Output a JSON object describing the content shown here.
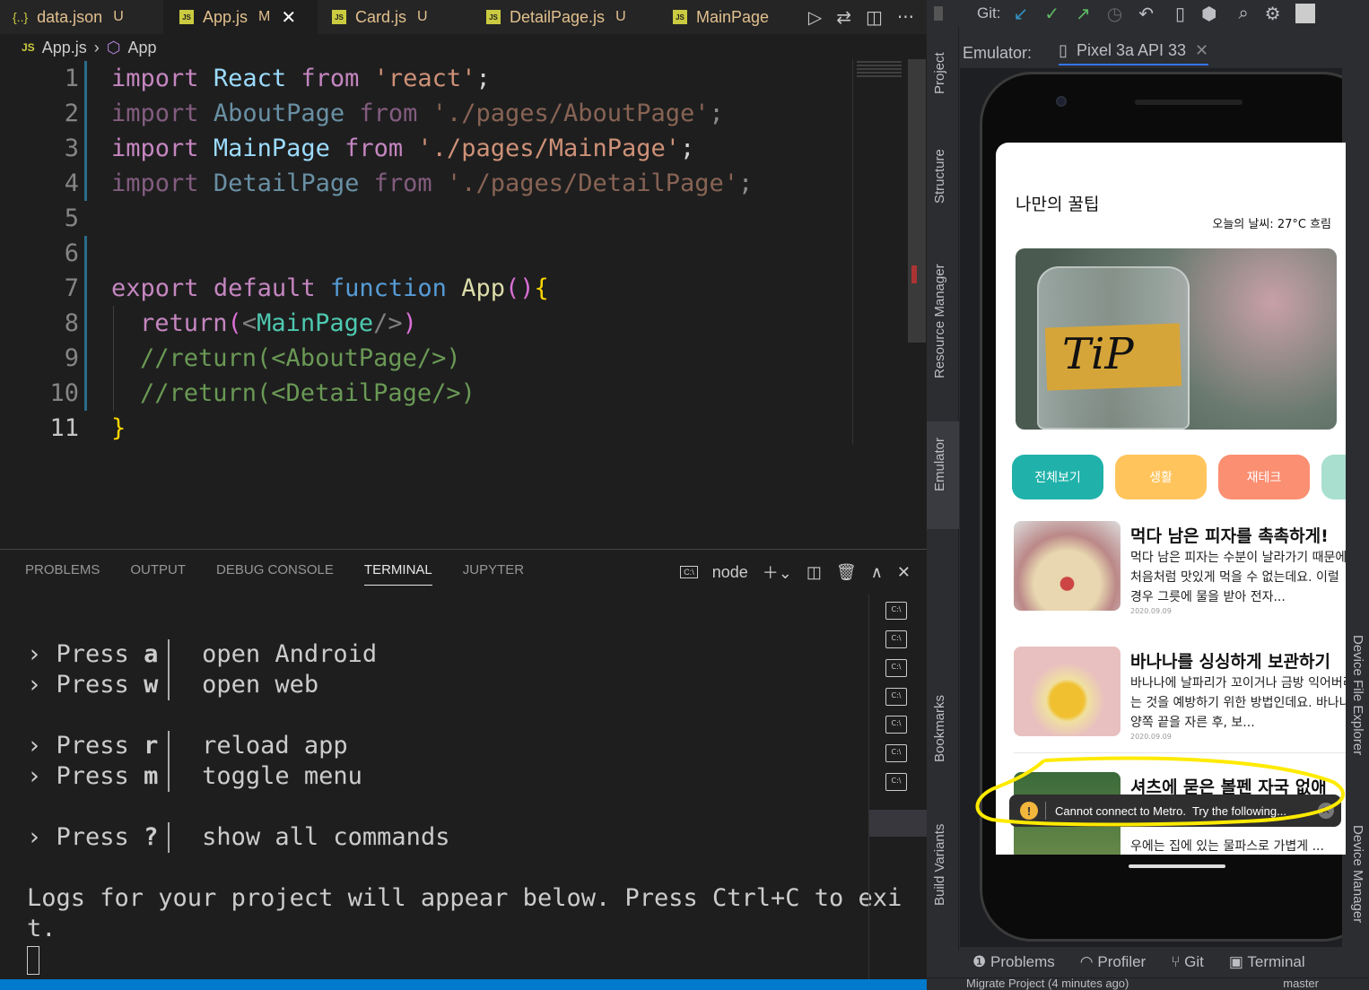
{
  "editor": {
    "tabs": [
      {
        "icon": "{..}",
        "name": "data.json",
        "status": "U"
      },
      {
        "icon": "JS",
        "name": "App.js",
        "status": "M"
      },
      {
        "icon": "JS",
        "name": "Card.js",
        "status": "U"
      },
      {
        "icon": "JS",
        "name": "DetailPage.js",
        "status": "U"
      },
      {
        "icon": "JS",
        "name": "MainPage",
        "status": ""
      }
    ],
    "breadcrumb": {
      "file": "App.js",
      "symbol": "App"
    },
    "line_numbers": [
      "1",
      "2",
      "3",
      "4",
      "5",
      "6",
      "7",
      "8",
      "9",
      "10",
      "11"
    ],
    "code": {
      "l1": [
        "import",
        "React",
        "from",
        "'react'",
        ";"
      ],
      "l2": [
        "import",
        "AboutPage",
        "from",
        "'./pages/AboutPage'",
        ";"
      ],
      "l3": [
        "import",
        "MainPage",
        "from",
        "'./pages/MainPage'",
        ";"
      ],
      "l4": [
        "import",
        "DetailPage",
        "from",
        "'./pages/DetailPage'",
        ";"
      ],
      "l7": [
        "export",
        "default",
        "function",
        "App",
        "()",
        "{"
      ],
      "l8": [
        "return",
        "(",
        "<",
        "MainPage",
        "/>",
        ")"
      ],
      "l9": "//return(<AboutPage/>)",
      "l10": "//return(<DetailPage/>)",
      "l11": "}"
    }
  },
  "panel": {
    "tabs": [
      "PROBLEMS",
      "OUTPUT",
      "DEBUG CONSOLE",
      "TERMINAL",
      "JUPYTER"
    ],
    "active_tab": "TERMINAL",
    "shell": "node",
    "terminal": [
      {
        "key": "a",
        "action": "open Android"
      },
      {
        "key": "w",
        "action": "open web"
      },
      {
        "key": "r",
        "action": "reload app"
      },
      {
        "key": "m",
        "action": "toggle menu"
      },
      {
        "key": "?",
        "action": "show all commands"
      }
    ],
    "press": "Press",
    "logs_line1": "Logs for your project will appear below. Press Ctrl+C to exi",
    "logs_line2": "t."
  },
  "studio": {
    "git_label": "Git:",
    "left_tools": [
      "Project",
      "Structure",
      "Resource Manager",
      "Emulator",
      "Bookmarks",
      "Build Variants"
    ],
    "right_tools": [
      "Device File Explorer",
      "Device Manager"
    ],
    "emulator_label": "Emulator:",
    "device_tab": "Pixel 3a API 33",
    "bottom_tabs": [
      "Problems",
      "Profiler",
      "Git",
      "Terminal"
    ],
    "status_left": "Migrate Project (4 minutes ago)",
    "status_right": "master"
  },
  "app": {
    "title": "나만의 꿀팁",
    "weather": "오늘의 날씨: 27°C 흐림",
    "hero_text": "TiP",
    "categories": [
      {
        "label": "전체보기",
        "color": "#20b2aa"
      },
      {
        "label": "생활",
        "color": "#ffc55c"
      },
      {
        "label": "재테크",
        "color": "#fa8f72"
      }
    ],
    "cards": [
      {
        "title": "먹다 남은 피자를 촉촉하게!",
        "desc": "먹다 남은 피자는 수분이 날라가기 때문에 처음처럼 맛있게 먹을 수 없는데요. 이럴 경우 그릇에 물을 받아 전자...",
        "date": "2020.09.09"
      },
      {
        "title": "바나나를 싱싱하게 보관하기",
        "desc": "바나나에 날파리가 꼬이거나 금방 익어버리는 것을 예방하기 위한 방법인데요. 바나나 양쪽 끝을 자른 후, 보...",
        "date": "2020.09.09"
      },
      {
        "title": "셔츠에 묻은 볼펜 자국 없애",
        "desc": "우에는 집에 있는 물파스로 가볍게 ...",
        "date": ""
      }
    ],
    "toast": "Cannot connect to Metro.  Try the following..."
  }
}
